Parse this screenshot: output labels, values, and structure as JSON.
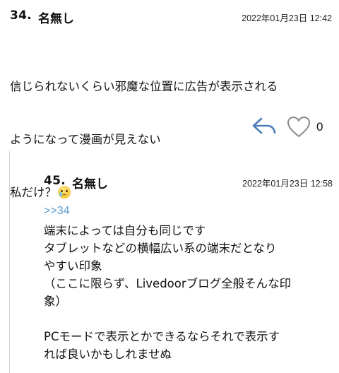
{
  "comment": {
    "number": "34.",
    "author": "名無し",
    "date": "2022年01月23日 12:42",
    "lines": [
      "信じられないくらい邪魔な位置に広告が表示される",
      "ようになって漫画が見えない",
      "私だけ？"
    ],
    "emoji": "crying-face",
    "like_count": "0"
  },
  "reply": {
    "number": "45.",
    "author": "名無し",
    "date": "2022年01月23日 12:58",
    "anchor": ">>34",
    "lines": [
      "端末によっては自分も同じです",
      "タブレットなどの横幅広い系の端末だとなり",
      "やすい印象",
      "（ここに限らず、Livedoorブログ全般そんな印",
      "象）",
      "",
      "PCモードで表示とかできるならそれで表示す",
      "れば良いかもしれませぬ"
    ]
  },
  "icons": {
    "reply": "reply-arrow-icon",
    "like": "heart-outline-icon"
  },
  "colors": {
    "link": "#5b9bd1",
    "reply_icon": "#4a7fb8",
    "heart_icon": "#888888",
    "thread_line": "#d6d6d6"
  }
}
